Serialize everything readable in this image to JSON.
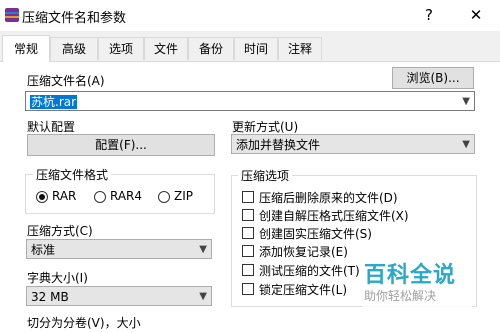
{
  "window": {
    "title": "压缩文件名和参数",
    "help_glyph": "?",
    "close_glyph": "✕"
  },
  "tabs": [
    "常规",
    "高级",
    "选项",
    "文件",
    "备份",
    "时间",
    "注释"
  ],
  "archive": {
    "label": "压缩文件名(A)",
    "browse_label": "浏览(B)...",
    "value": "苏杭.rar"
  },
  "default_profile": {
    "label": "默认配置",
    "button_label": "配置(F)..."
  },
  "update_mode": {
    "label": "更新方式(U)",
    "value": "添加并替换文件"
  },
  "format": {
    "label": "压缩文件格式",
    "options": [
      "RAR",
      "RAR4",
      "ZIP"
    ],
    "selected": "RAR"
  },
  "method": {
    "label": "压缩方式(C)",
    "value": "标准"
  },
  "dictionary": {
    "label": "字典大小(I)",
    "value": "32 MB"
  },
  "split": {
    "label": "切分为分卷(V)，大小"
  },
  "options": {
    "label": "压缩选项",
    "items": [
      "压缩后删除原来的文件(D)",
      "创建自解压格式压缩文件(X)",
      "创建固实压缩文件(S)",
      "添加恢复记录(E)",
      "测试压缩的文件(T)",
      "锁定压缩文件(L)"
    ]
  },
  "watermark": {
    "title": "百科全说",
    "subtitle": "助你轻松解决"
  },
  "colors": {
    "selection": "#0078d7",
    "watermark": "#27a9c7"
  }
}
